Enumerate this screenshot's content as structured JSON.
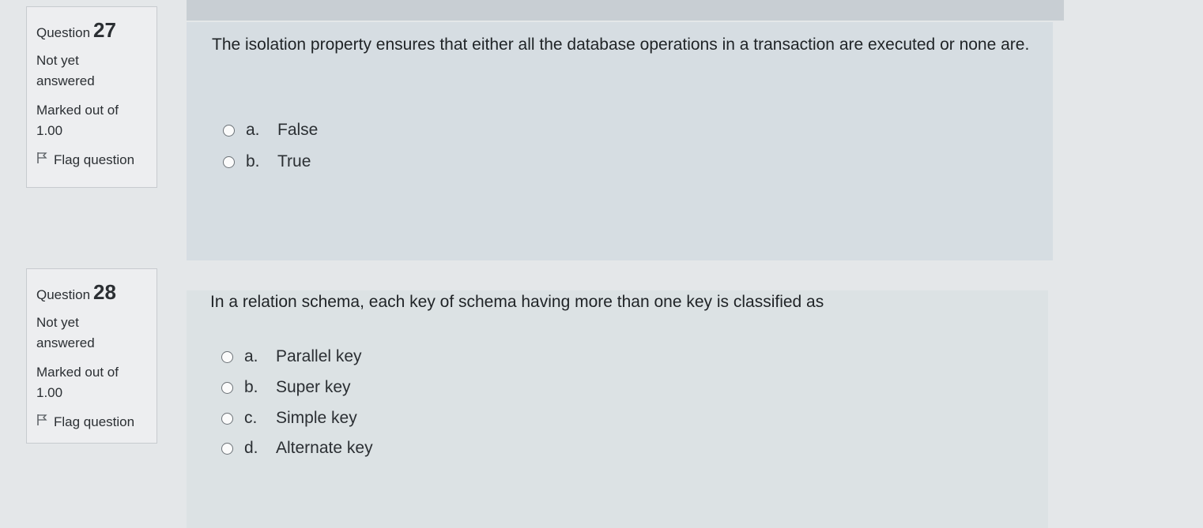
{
  "questions": [
    {
      "label": "Question",
      "number": "27",
      "state": "Not yet answered",
      "state_line1": "Not yet",
      "state_line2": "answered",
      "marked_line1": "Marked out of",
      "marked_line2": "1.00",
      "flag_label": "Flag question",
      "text": "The isolation property ensures that either all the database operations in a transaction are executed or none are.",
      "answers": [
        {
          "letter": "a.",
          "label": "False"
        },
        {
          "letter": "b.",
          "label": "True"
        }
      ]
    },
    {
      "label": "Question",
      "number": "28",
      "state_line1": "Not yet",
      "state_line2": "answered",
      "marked_line1": "Marked out of",
      "marked_line2": "1.00",
      "flag_label": "Flag question",
      "text": "In a relation schema, each key of schema having more than one key is classified as",
      "answers": [
        {
          "letter": "a.",
          "label": "Parallel key"
        },
        {
          "letter": "b.",
          "label": "Super key"
        },
        {
          "letter": "c.",
          "label": "Simple key"
        },
        {
          "letter": "d.",
          "label": "Alternate key"
        }
      ]
    }
  ]
}
